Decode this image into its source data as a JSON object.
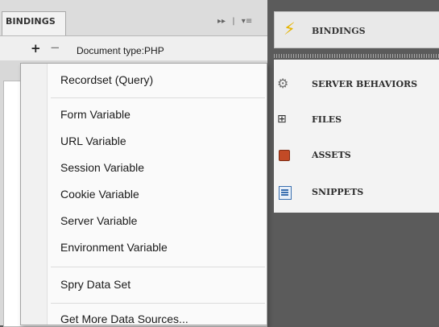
{
  "panel": {
    "tab_label": "BINDINGS",
    "controls": [
      "▸▸",
      "|",
      "▾≡"
    ],
    "plus": "+",
    "minus": "−",
    "document_type": "Document type:PHP"
  },
  "right_panel": {
    "header": "BINDINGS",
    "items": [
      {
        "label": "SERVER BEHAVIORS",
        "icon": "server-behaviors-icon"
      },
      {
        "label": "FILES",
        "icon": "files-icon"
      },
      {
        "label": "ASSETS",
        "icon": "assets-icon"
      },
      {
        "label": "SNIPPETS",
        "icon": "snippets-icon"
      }
    ]
  },
  "menu": {
    "items": [
      "Recordset (Query)",
      "Form Variable",
      "URL Variable",
      "Session Variable",
      "Cookie Variable",
      "Server Variable",
      "Environment Variable",
      "Spry Data Set",
      "Get More Data Sources..."
    ]
  },
  "colors": {
    "bolt": "#e6b400",
    "assets": "#c24a26",
    "snippets": "#3a6fb0"
  }
}
